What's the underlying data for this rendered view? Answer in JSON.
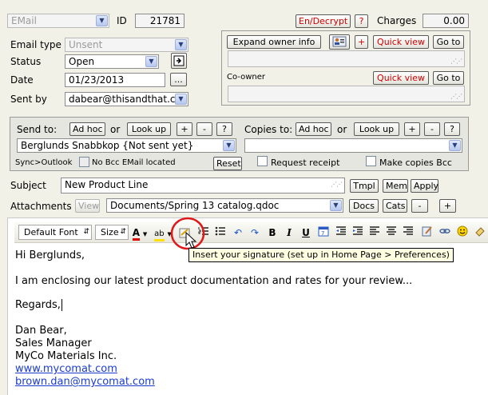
{
  "header": {
    "type_value": "EMail",
    "id_label": "ID",
    "id_value": "21781",
    "endecrypt_label": "En/Decrypt",
    "help_label": "?",
    "charges_label": "Charges",
    "charges_value": "0.00"
  },
  "form": {
    "email_type_label": "Email type",
    "email_type_value": "Unsent",
    "status_label": "Status",
    "status_value": "Open",
    "date_label": "Date",
    "date_value": "01/23/2013",
    "date_picker_label": "...",
    "sent_by_label": "Sent by",
    "sent_by_value": "dabear@thisandthat.cor"
  },
  "owner": {
    "expand_label": "Expand owner info",
    "plus_label": "+",
    "quick_view_label": "Quick view",
    "go_to_label": "Go to",
    "coowner_label": "Co-owner",
    "coowner_quick_view_label": "Quick view",
    "coowner_go_to_label": "Go to"
  },
  "recipients": {
    "send_to_label": "Send to:",
    "adhoc_label": "Ad hoc",
    "or_label": "or",
    "lookup_label": "Look up",
    "plus_label": "+",
    "minus_label": "-",
    "help_label": "?",
    "send_to_value": "Berglunds Snabbkop {Not sent yet}",
    "copies_to_label": "Copies to:",
    "copies_adhoc_label": "Ad hoc",
    "copies_or_label": "or",
    "copies_lookup_label": "Look up",
    "sync_label": "Sync>Outlook",
    "no_bcc_label": "No Bcc EMail located",
    "reset_label": "Reset",
    "request_receipt_label": "Request receipt",
    "make_copies_label": "Make copies Bcc"
  },
  "subject": {
    "label": "Subject",
    "value": "New Product Line",
    "tmpl_label": "Tmpl",
    "mem_label": "Mem",
    "apply_label": "Apply"
  },
  "attachments": {
    "label": "Attachments",
    "view_label": "View",
    "value": "Documents/Spring 13 catalog.qdoc",
    "docs_label": "Docs",
    "cats_label": "Cats",
    "minus_label": "-",
    "plus_label": "+"
  },
  "toolbar": {
    "font_value": "Default Font",
    "size_value": "Size",
    "font_color_glyph": "A",
    "highlight_glyph": "ab",
    "bold": "B",
    "italic": "I",
    "underline": "U"
  },
  "tooltip": "Insert your signature (set up in Home Page > Preferences)",
  "message": {
    "lines": [
      "Hi Berglunds,",
      "I am enclosing our latest product documentation and rates for your review...",
      "Regards,",
      "Dan Bear,",
      "Sales Manager",
      "MyCo Materials Inc.",
      "www.mycomat.com",
      "brown.dan@mycomat.com"
    ]
  }
}
